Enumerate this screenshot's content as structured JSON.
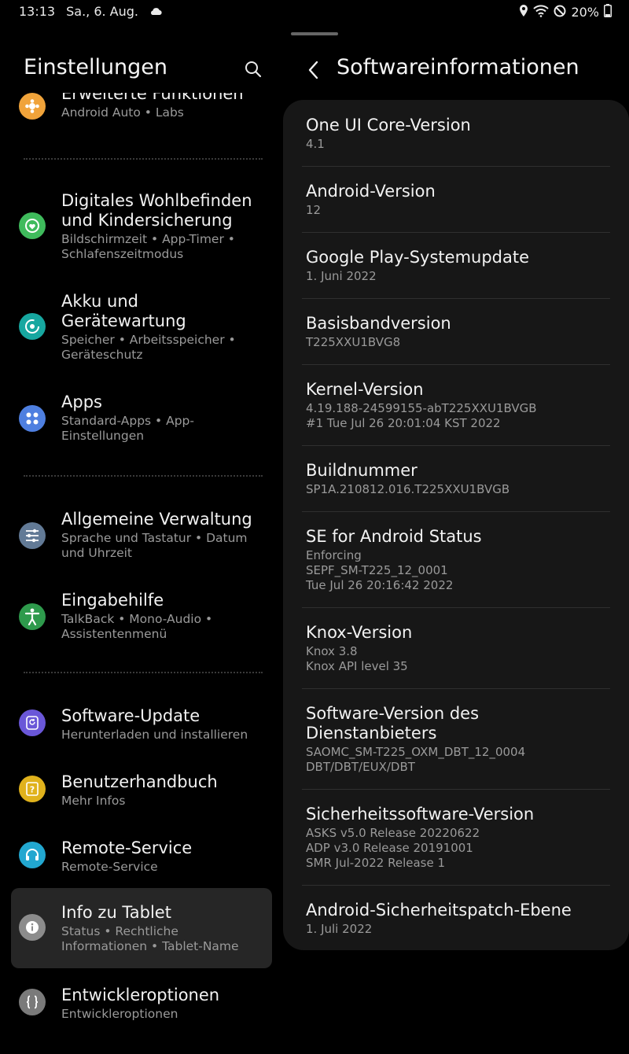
{
  "status_bar": {
    "time": "13:13",
    "date": "Sa., 6. Aug.",
    "battery": "20%"
  },
  "left_panel": {
    "title": "Einstellungen",
    "items": [
      {
        "title": "Erweiterte Funktionen",
        "subtitle": "Android Auto  •  Labs",
        "icon": "star-gear-icon",
        "color": "#f0a33a"
      },
      {
        "title": "Digitales Wohlbefinden und Kindersicherung",
        "subtitle": "Bildschirmzeit  •  App-Timer  •  Schlafenszeitmodus",
        "icon": "heart-icon",
        "color": "#3fbb5c"
      },
      {
        "title": "Akku und Gerätewartung",
        "subtitle": "Speicher  •  Arbeitsspeicher  •  Geräteschutz",
        "icon": "refresh-circle-icon",
        "color": "#17a7a0"
      },
      {
        "title": "Apps",
        "subtitle": "Standard-Apps  •  App-Einstellungen",
        "icon": "apps-grid-icon",
        "color": "#4e7fe0"
      },
      {
        "title": "Allgemeine Verwaltung",
        "subtitle": "Sprache und Tastatur  •  Datum und Uhrzeit",
        "icon": "sliders-icon",
        "color": "#627a96"
      },
      {
        "title": "Eingabehilfe",
        "subtitle": "TalkBack  •  Mono-Audio  •  Assistentenmenü",
        "icon": "accessibility-icon",
        "color": "#2e9a4c"
      },
      {
        "title": "Software-Update",
        "subtitle": "Herunterladen und installieren",
        "icon": "update-icon",
        "color": "#6a57d8"
      },
      {
        "title": "Benutzerhandbuch",
        "subtitle": "Mehr Infos",
        "icon": "manual-icon",
        "color": "#e0b21c"
      },
      {
        "title": "Remote-Service",
        "subtitle": "Remote-Service",
        "icon": "headset-icon",
        "color": "#22a7d0"
      },
      {
        "title": "Info zu Tablet",
        "subtitle": "Status  •  Rechtliche Informationen  •  Tablet-Name",
        "icon": "info-icon",
        "color": "#8c8c8c"
      },
      {
        "title": "Entwickleroptionen",
        "subtitle": "Entwickleroptionen",
        "icon": "braces-icon",
        "color": "#7a7a7a"
      }
    ]
  },
  "right_panel": {
    "title": "Softwareinformationen",
    "rows": [
      {
        "title": "One UI Core-Version",
        "value": "4.1"
      },
      {
        "title": "Android-Version",
        "value": "12"
      },
      {
        "title": "Google Play-Systemupdate",
        "value": "1. Juni 2022"
      },
      {
        "title": "Basisbandversion",
        "value": "T225XXU1BVG8"
      },
      {
        "title": "Kernel-Version",
        "value": "4.19.188-24599155-abT225XXU1BVGB\n#1 Tue Jul 26 20:01:04 KST 2022"
      },
      {
        "title": "Buildnummer",
        "value": "SP1A.210812.016.T225XXU1BVGB"
      },
      {
        "title": "SE for Android Status",
        "value": "Enforcing\nSEPF_SM-T225_12_0001\nTue Jul 26 20:16:42 2022"
      },
      {
        "title": "Knox-Version",
        "value": "Knox 3.8\nKnox API level 35"
      },
      {
        "title": "Software-Version des Dienstanbieters",
        "value": "SAOMC_SM-T225_OXM_DBT_12_0004\nDBT/DBT/EUX/DBT"
      },
      {
        "title": "Sicherheitssoftware-Version",
        "value": "ASKS v5.0 Release 20220622\nADP v3.0 Release 20191001\nSMR Jul-2022 Release 1"
      },
      {
        "title": "Android-Sicherheitspatch-Ebene",
        "value": "1. Juli 2022"
      }
    ]
  }
}
